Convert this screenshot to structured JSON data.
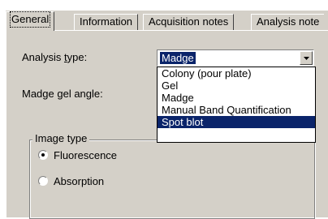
{
  "tabs": [
    {
      "label": "General",
      "active": true
    },
    {
      "label": "Information",
      "active": false
    },
    {
      "label": "Acquisition notes",
      "active": false
    },
    {
      "label": "Analysis note",
      "active": false
    }
  ],
  "analysis_type": {
    "label_pre": "Analysis ",
    "label_accel": "t",
    "label_post": "ype:",
    "selected": "Madge",
    "options": [
      "Colony (pour plate)",
      "Gel",
      "Madge",
      "Manual Band Quantification",
      "Spot blot"
    ],
    "highlighted_option": "Spot blot"
  },
  "madge_gel_angle": {
    "label": "Madge gel angle:"
  },
  "image_type": {
    "title": "Image type",
    "options": [
      {
        "label": "Fluorescence",
        "checked": true
      },
      {
        "label": "Absorption",
        "checked": false
      }
    ]
  },
  "colors": {
    "selection": "#0a246a",
    "face": "#d4d0c8"
  }
}
